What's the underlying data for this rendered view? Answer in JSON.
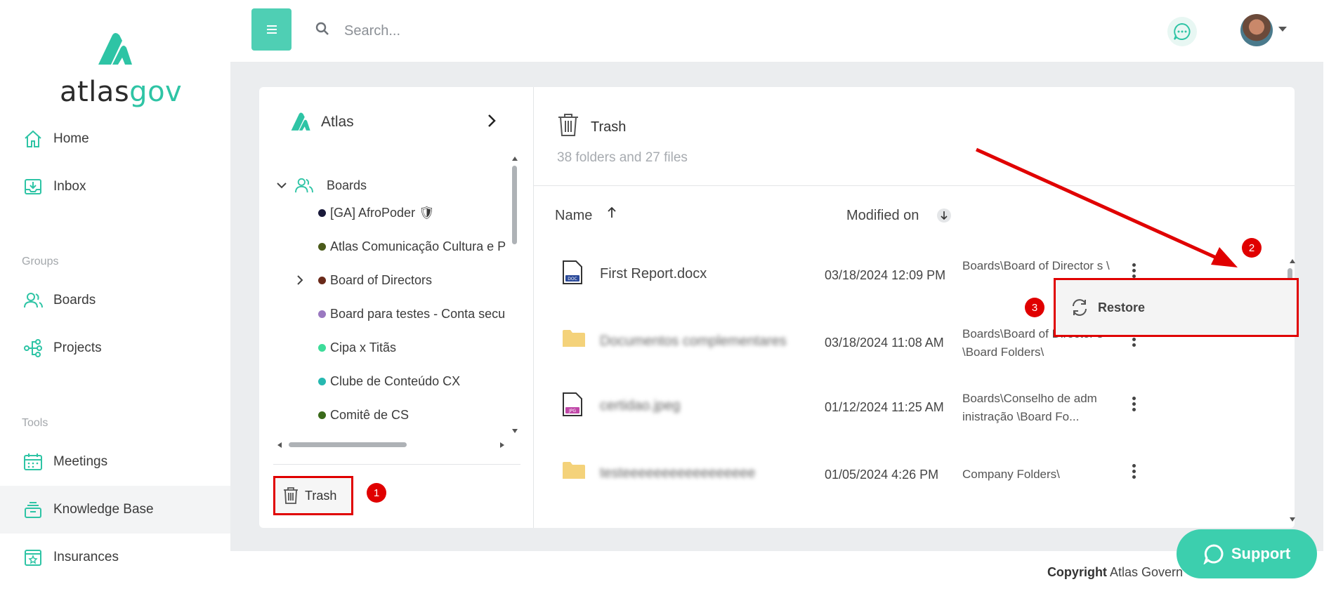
{
  "brand": {
    "logo_dark": "atlas",
    "logo_teal": "gov"
  },
  "sidebar": {
    "items": [
      {
        "label": "Home",
        "icon": "home-icon"
      },
      {
        "label": "Inbox",
        "icon": "inbox-icon"
      },
      {
        "label": "Boards",
        "icon": "users-icon"
      },
      {
        "label": "Projects",
        "icon": "projects-icon"
      },
      {
        "label": "Meetings",
        "icon": "calendar-icon"
      },
      {
        "label": "Knowledge Base",
        "icon": "knowledge-base-icon"
      },
      {
        "label": "Insurances",
        "icon": "insurance-icon"
      }
    ],
    "groups_label": "Groups",
    "tools_label": "Tools"
  },
  "topbar": {
    "search_placeholder": "Search..."
  },
  "left_panel": {
    "title": "Atlas",
    "boards_label": "Boards",
    "tree": [
      {
        "label": "[GA] AfroPoder 🛡",
        "color": "#1a1a3a"
      },
      {
        "label": "Atlas Comunicação Cultura e P",
        "color": "#4a5a1a"
      },
      {
        "label": "Board of Directors",
        "color": "#6a2a1a"
      },
      {
        "label": "Board para testes - Conta secu",
        "color": "#9a78c0"
      },
      {
        "label": "Cipa x Titãs",
        "color": "#3ddc9a"
      },
      {
        "label": "Clube de Conteúdo CX",
        "color": "#26b8b0"
      },
      {
        "label": "Comitê de CS",
        "color": "#3a6a1a"
      }
    ],
    "trash_label": "Trash"
  },
  "right_panel": {
    "title": "Trash",
    "subtitle": "38 folders and 27 files",
    "col_name": "Name",
    "col_modified": "Modified on",
    "rows": [
      {
        "name": "First Report.docx",
        "date": "03/18/2024 12:09 PM",
        "path": "Boards\\Board of Director s \\",
        "icon": "doc-file-icon"
      },
      {
        "name": "Documentos complementares",
        "date": "03/18/2024 11:08 AM",
        "path": "Boards\\Board of Director s \\Board Folders\\",
        "icon": "folder-icon"
      },
      {
        "name": "certidao.jpeg",
        "date": "01/12/2024 11:25 AM",
        "path": "Boards\\Conselho de adm inistração \\Board Fo...",
        "icon": "jpg-file-icon"
      },
      {
        "name": "testeeeeeeeeeeeeeeeee",
        "date": "01/05/2024 4:26 PM",
        "path": "Company Folders\\",
        "icon": "folder-icon"
      }
    ],
    "restore_label": "Restore"
  },
  "markers": [
    "1",
    "2",
    "3"
  ],
  "footer": {
    "copyright_bold": "Copyright",
    "copyright_rest": "Atlas Govern"
  },
  "support_label": "Support",
  "colors": {
    "accent": "#3ccfae",
    "annotation": "#e00000"
  }
}
